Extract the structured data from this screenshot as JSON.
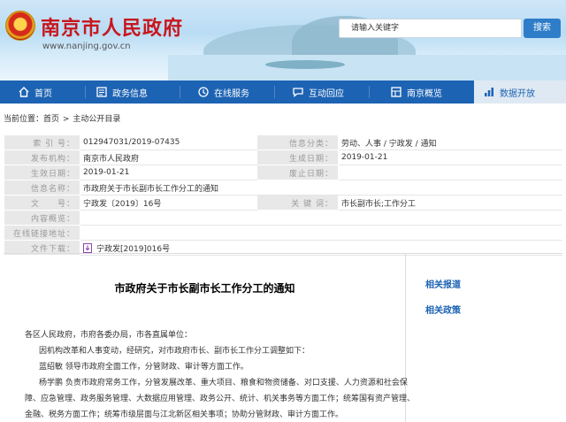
{
  "header": {
    "site_title": "南京市人民政府",
    "site_url": "www.nanjing.gov.cn",
    "search_placeholder": "请输入关键字",
    "search_button": "搜索"
  },
  "nav": {
    "items": [
      {
        "label": "首页",
        "icon": "home-icon"
      },
      {
        "label": "政务信息",
        "icon": "news-icon"
      },
      {
        "label": "在线服务",
        "icon": "service-icon"
      },
      {
        "label": "互动回应",
        "icon": "chat-icon"
      },
      {
        "label": "南京概览",
        "icon": "overview-icon"
      },
      {
        "label": "数据开放",
        "icon": "data-icon",
        "active": true
      }
    ]
  },
  "breadcrumb": {
    "prefix": "当前位置：",
    "home": "首页",
    "sep": ">",
    "current": "主动公开目录"
  },
  "info": {
    "index_label": "索 引 号：",
    "index_value": "012947031/2019-07435",
    "category_label": "信息分类：",
    "category_value": "劳动、人事 / 宁政发 / 通知",
    "publisher_label": "发布机构：",
    "publisher_value": "南京市人民政府",
    "created_label": "生成日期：",
    "created_value": "2019-01-21",
    "effective_label": "生效日期：",
    "effective_value": "2019-01-21",
    "expire_label": "废止日期：",
    "expire_value": "",
    "name_label": "信息名称：",
    "name_value": "市政府关于市长副市长工作分工的通知",
    "docno_label": "文　　号：",
    "docno_value": "宁政发〔2019〕16号",
    "keywords_label": "关 键 词：",
    "keywords_value": "市长副市长;工作分工",
    "summary_label": "内容概览：",
    "summary_value": "",
    "online_label": "在线链接地址：",
    "online_value": "",
    "download_label": "文件下载：",
    "download_value": "宁政发[2019]016号"
  },
  "article": {
    "title": "市政府关于市长副市长工作分工的通知",
    "addressee": "各区人民政府，市府各委办局，市各直属单位：",
    "para1": "因机构改革和人事变动，经研究，对市政府市长、副市长工作分工调整如下：",
    "para2": "蓝绍敏  领导市政府全面工作，分管财政、审计等方面工作。",
    "para3_line1": "杨学鹏  负责市政府常务工作，分管发展改革、重大项目、粮食和物资储备、对口支援、人力资源和社会保",
    "para3_line2": "障、应急管理、政务服务管理、大数据应用管理、政务公开、统计、机关事务等方面工作；统筹国有资产管理、",
    "para3_line3": "金融、税务方面工作；统筹市级层面与江北新区相关事项；协助分管财政、审计方面工作。"
  },
  "sidebar": {
    "link1": "相关报道",
    "link2": "相关政策"
  },
  "colors": {
    "brand_red": "#c8161d",
    "nav_blue": "#1d63b3",
    "link_blue": "#1d63b3",
    "label_bg": "#e8e8e8"
  }
}
